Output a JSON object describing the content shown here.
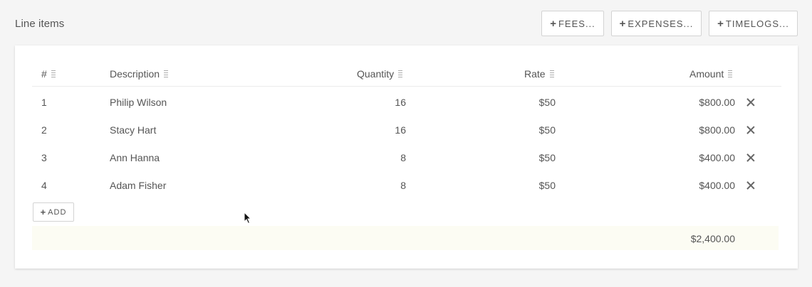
{
  "header": {
    "title": "Line items",
    "buttons": {
      "fees": "FEES...",
      "expenses": "EXPENSES...",
      "timelogs": "TIMELOGS..."
    }
  },
  "table": {
    "columns": {
      "index": "#",
      "description": "Description",
      "quantity": "Quantity",
      "rate": "Rate",
      "amount": "Amount"
    },
    "rows": [
      {
        "index": "1",
        "description": "Philip Wilson",
        "quantity": "16",
        "rate": "$50",
        "amount": "$800.00"
      },
      {
        "index": "2",
        "description": "Stacy Hart",
        "quantity": "16",
        "rate": "$50",
        "amount": "$800.00"
      },
      {
        "index": "3",
        "description": "Ann Hanna",
        "quantity": "8",
        "rate": "$50",
        "amount": "$400.00"
      },
      {
        "index": "4",
        "description": "Adam Fisher",
        "quantity": "8",
        "rate": "$50",
        "amount": "$400.00"
      }
    ],
    "add_label": "ADD",
    "total": "$2,400.00"
  },
  "icons": {
    "plus": "plus-icon",
    "sort": "sort-handle-icon",
    "remove": "close-icon"
  }
}
